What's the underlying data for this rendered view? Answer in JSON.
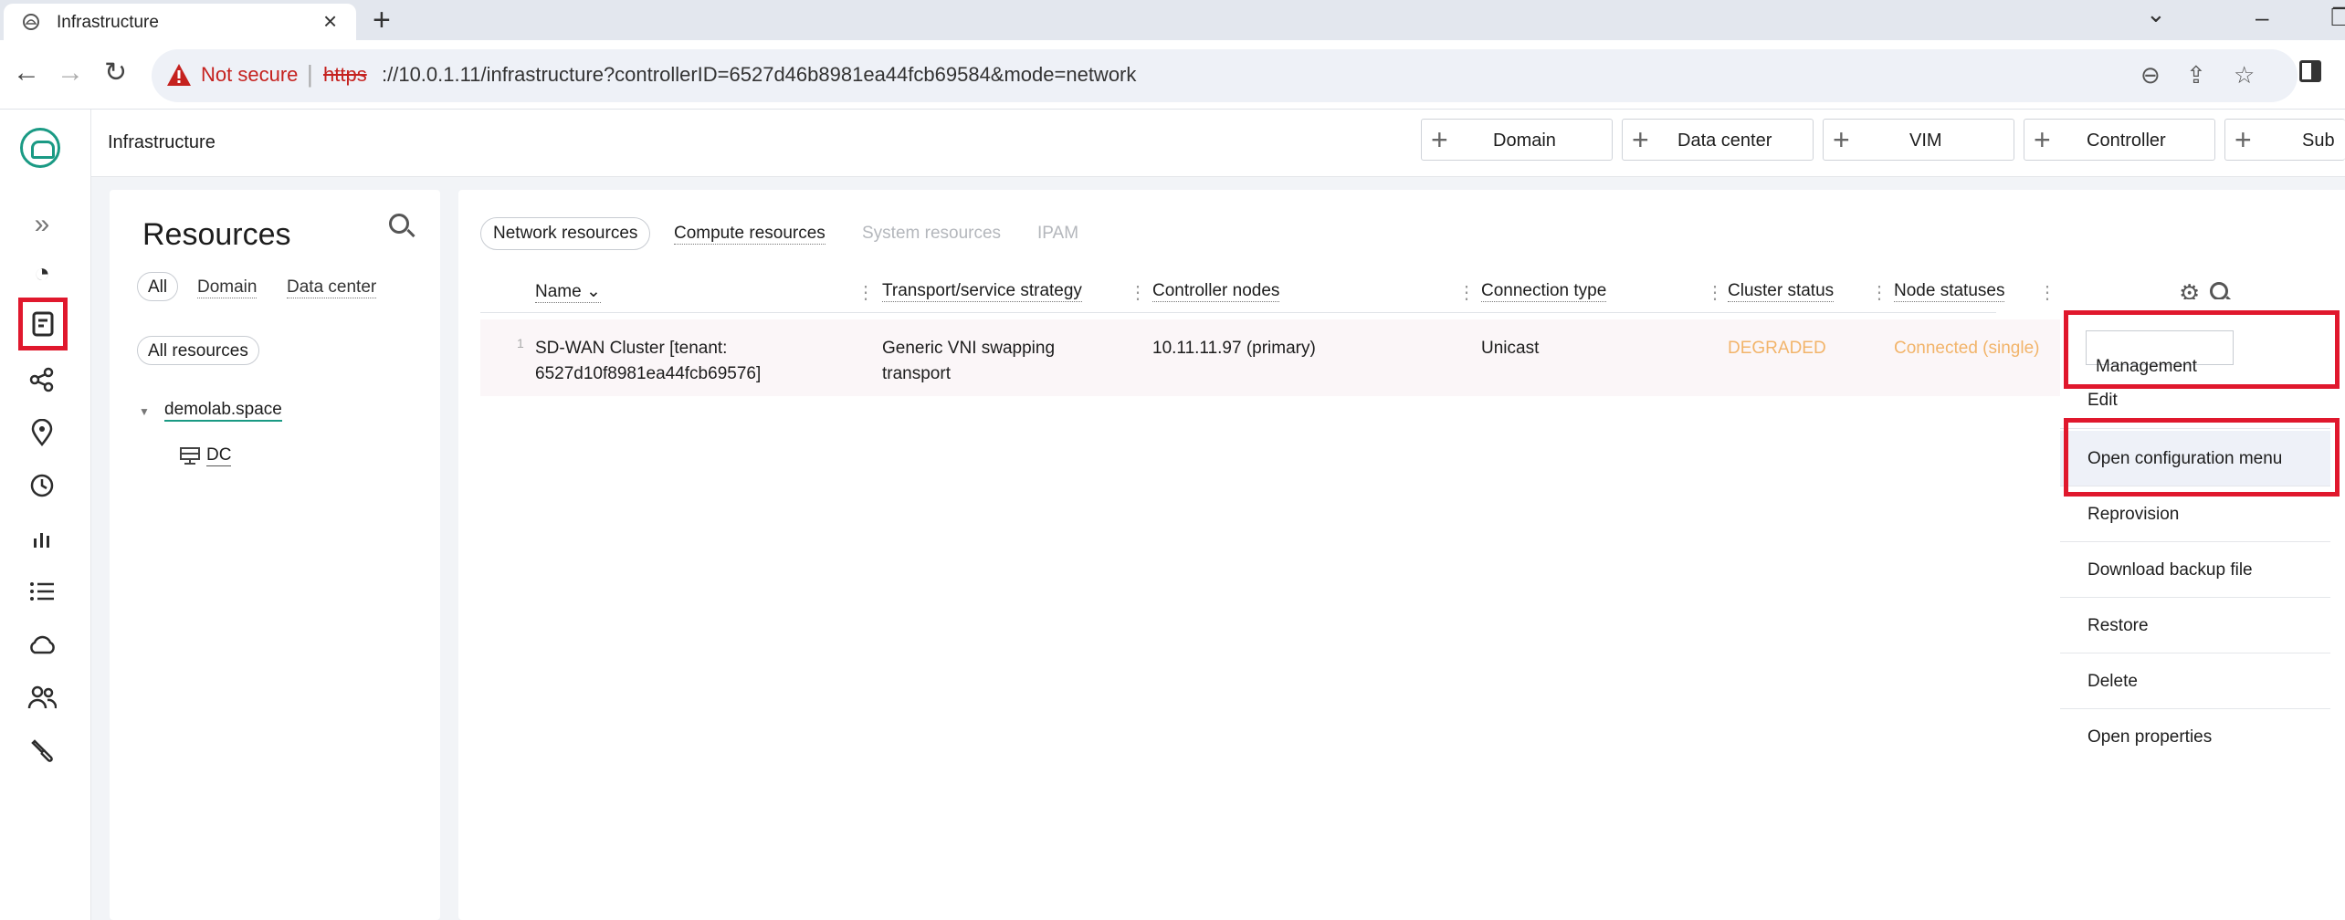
{
  "browser": {
    "tab_title": "Infrastructure",
    "tab_close": "×",
    "new_tab": "+",
    "not_secure": "Not secure",
    "url_scheme": "https",
    "url_rest": "://10.0.1.11/infrastructure?controllerID=6527d46b8981ea44fcb69584&mode=network"
  },
  "header": {
    "title": "Infrastructure",
    "add_buttons": [
      "Domain",
      "Data center",
      "VIM",
      "Controller",
      "Sub"
    ]
  },
  "resources": {
    "title": "Resources",
    "filters": {
      "all": "All",
      "domain": "Domain",
      "data_center": "Data center"
    },
    "all_resources": "All resources",
    "tree_domain": "demolab.space",
    "tree_dc": "DC"
  },
  "main": {
    "tabs": {
      "network": "Network resources",
      "compute": "Compute resources",
      "system": "System resources",
      "ipam": "IPAM"
    },
    "columns": {
      "name": "Name",
      "strategy": "Transport/service strategy",
      "controller_nodes": "Controller nodes",
      "connection_type": "Connection type",
      "cluster_status": "Cluster status",
      "node_statuses": "Node statuses"
    },
    "row": {
      "num": "1",
      "name_line1": "SD-WAN Cluster [tenant:",
      "name_line2": "6527d10f8981ea44fcb69576]",
      "strategy_line1": "Generic VNI swapping",
      "strategy_line2": "transport",
      "controller_nodes": "10.11.11.97 (primary)",
      "connection_type": "Unicast",
      "cluster_status": "DEGRADED",
      "node_statuses": "Connected (single)"
    }
  },
  "menu": {
    "management": "Management",
    "edit": "Edit",
    "open_config": "Open configuration menu",
    "reprovision": "Reprovision",
    "download_backup": "Download backup file",
    "restore": "Restore",
    "delete": "Delete",
    "open_properties": "Open properties"
  },
  "colors": {
    "accent": "#1a9a84",
    "highlight_red": "#e0182d",
    "warning_orange": "#f2b46a",
    "not_secure_red": "#c5221f"
  },
  "icons": {
    "rail": [
      "expand-icon",
      "dashboard-icon",
      "infrastructure-icon",
      "topology-icon",
      "location-icon",
      "history-icon",
      "statistics-icon",
      "list-icon",
      "cloud-icon",
      "users-icon",
      "tools-icon"
    ]
  }
}
